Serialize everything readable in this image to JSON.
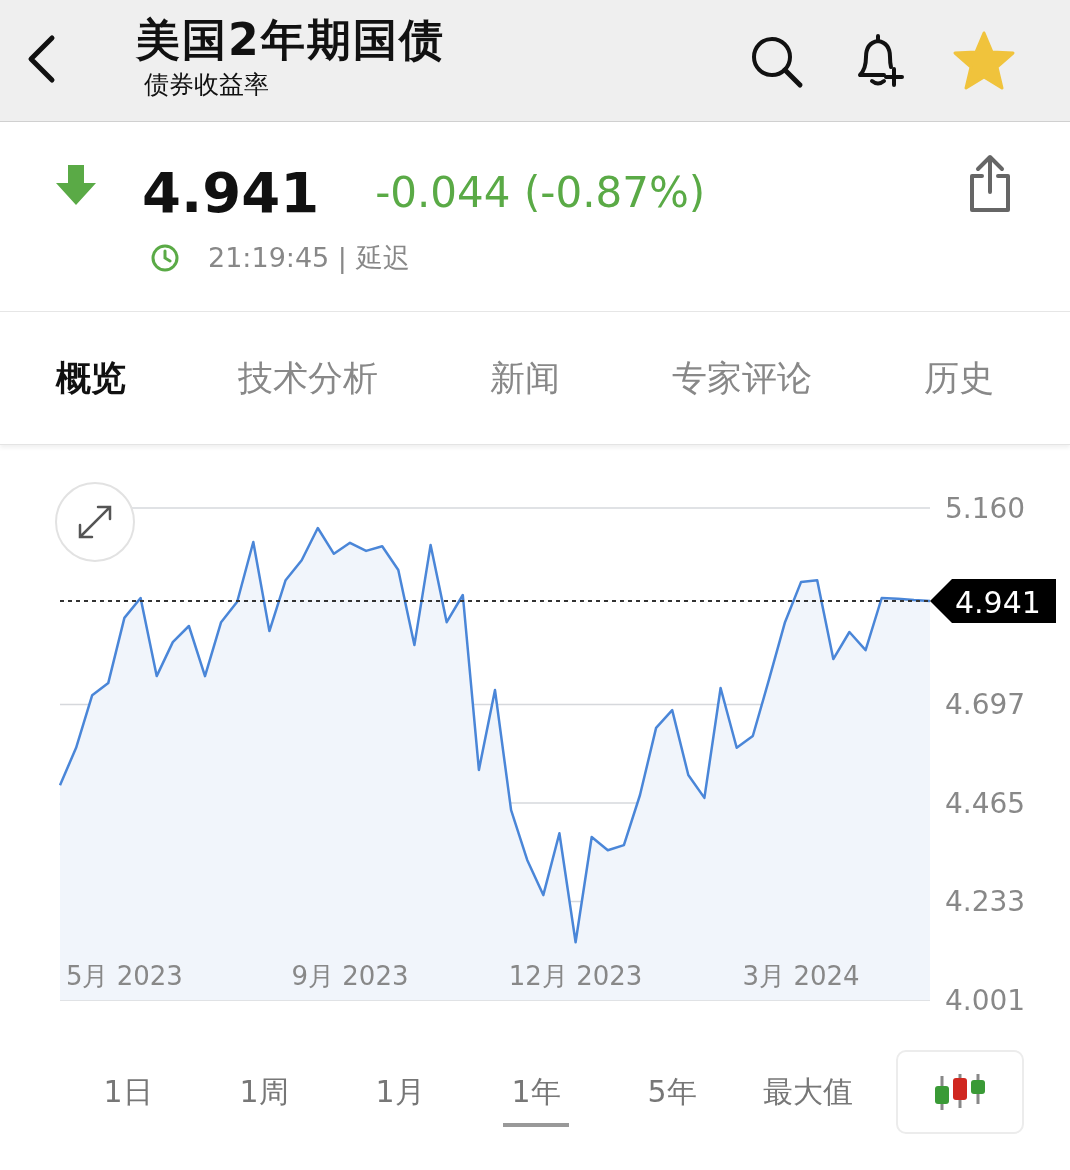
{
  "header": {
    "title": "美国2年期国债",
    "subtitle": "债券收益率",
    "starred": true
  },
  "quote": {
    "falling": true,
    "price": "4.941",
    "change": "-0.044 (-0.87%)",
    "time": "21:19:45 | 延迟"
  },
  "tabs": [
    {
      "label": "概览",
      "selected": true
    },
    {
      "label": "技术分析",
      "selected": false
    },
    {
      "label": "新闻",
      "selected": false
    },
    {
      "label": "专家评论",
      "selected": false
    },
    {
      "label": "历史",
      "selected": false
    }
  ],
  "chart": {
    "chart_data": {
      "type": "area",
      "grid": true,
      "categories": [
        null,
        null,
        null,
        null,
        "5月 2023",
        null,
        null,
        null,
        null,
        null,
        null,
        null,
        null,
        null,
        null,
        null,
        null,
        null,
        "9月 2023",
        null,
        null,
        null,
        null,
        null,
        null,
        null,
        null,
        null,
        null,
        null,
        null,
        null,
        "12月 2023",
        null,
        null,
        null,
        null,
        null,
        null,
        null,
        null,
        null,
        null,
        null,
        null,
        null,
        "3月 2024",
        null,
        null,
        null,
        null,
        null,
        null,
        null,
        null
      ],
      "ylim": [
        4.001,
        5.16
      ],
      "yticks": [
        {
          "value": 5.16,
          "label": "5.160"
        },
        {
          "value": 4.697,
          "label": "4.697"
        },
        {
          "value": 4.465,
          "label": "4.465"
        },
        {
          "value": 4.233,
          "label": "4.233"
        },
        {
          "value": 4.001,
          "label": "4.001"
        }
      ],
      "series": [
        {
          "color": "#4a86d8",
          "values": [
            4.507,
            4.595,
            4.719,
            4.748,
            4.901,
            4.948,
            4.764,
            4.844,
            4.882,
            4.764,
            4.891,
            4.939,
            5.08,
            4.87,
            4.99,
            5.037,
            5.113,
            5.052,
            5.078,
            5.059,
            5.07,
            5.014,
            4.837,
            5.073,
            4.891,
            4.955,
            4.543,
            4.731,
            4.448,
            4.331,
            4.248,
            4.394,
            4.137,
            4.385,
            4.354,
            4.366,
            4.484,
            4.642,
            4.684,
            4.531,
            4.477,
            4.736,
            4.595,
            4.623,
            4.755,
            4.891,
            4.986,
            4.99,
            4.804,
            4.868,
            4.825,
            4.948,
            4.946,
            4.943,
            4.941
          ]
        }
      ],
      "ref_lines": [
        {
          "axis": "y",
          "value": 4.941,
          "label": "4.941"
        }
      ]
    }
  },
  "ranges": [
    {
      "label": "1日",
      "selected": false
    },
    {
      "label": "1周",
      "selected": false
    },
    {
      "label": "1月",
      "selected": false
    },
    {
      "label": "1年",
      "selected": true
    },
    {
      "label": "5年",
      "selected": false
    },
    {
      "label": "最大值",
      "selected": false
    }
  ]
}
